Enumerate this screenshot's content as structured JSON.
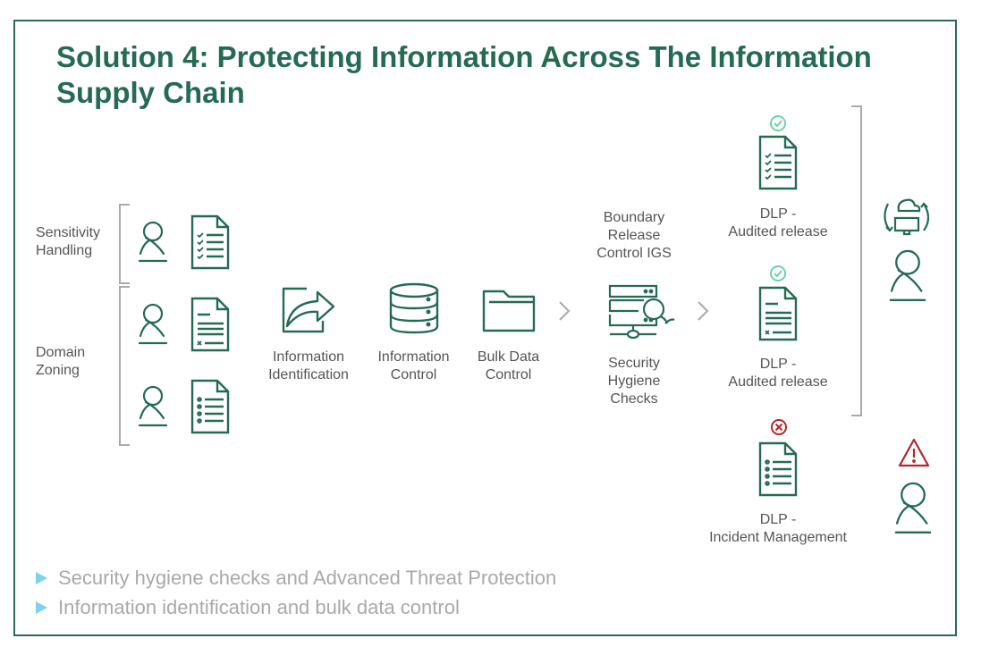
{
  "title": "Solution 4: Protecting Information Across The Information Supply Chain",
  "colors": {
    "primary": "#256b52",
    "label": "#555555",
    "bracket": "#aaaaaa",
    "ok": "#6fd1a8",
    "error": "#b3262e",
    "bullet_marker": "#7dd3ee",
    "bullet_text": "#a9a9a9"
  },
  "groups": {
    "sensitivity": {
      "label_line1": "Sensitivity",
      "label_line2": "Handling"
    },
    "domain": {
      "label_line1": "Domain",
      "label_line2": "Zoning"
    }
  },
  "steps": {
    "identification": {
      "line1": "Information",
      "line2": "Identification",
      "icon": "share-arrow-icon"
    },
    "control": {
      "line1": "Information",
      "line2": "Control",
      "icon": "database-icon"
    },
    "bulk": {
      "line1": "Bulk Data",
      "line2": "Control",
      "icon": "folder-icon"
    },
    "boundary": {
      "line1": "Boundary",
      "line2": "Release",
      "line3": "Control IGS"
    },
    "hygiene": {
      "line1": "Security",
      "line2": "Hygiene",
      "line3": "Checks",
      "icon": "server-search-icon"
    }
  },
  "outcomes": [
    {
      "status": "approved",
      "line1": "DLP -",
      "line2": "Audited release"
    },
    {
      "status": "approved",
      "line1": "DLP -",
      "line2": "Audited release"
    },
    {
      "status": "rejected",
      "line1": "DLP -",
      "line2": "Incident Management"
    }
  ],
  "bullets": [
    "Security hygiene checks and Advanced Threat Protection",
    "Information identification and bulk data control"
  ]
}
